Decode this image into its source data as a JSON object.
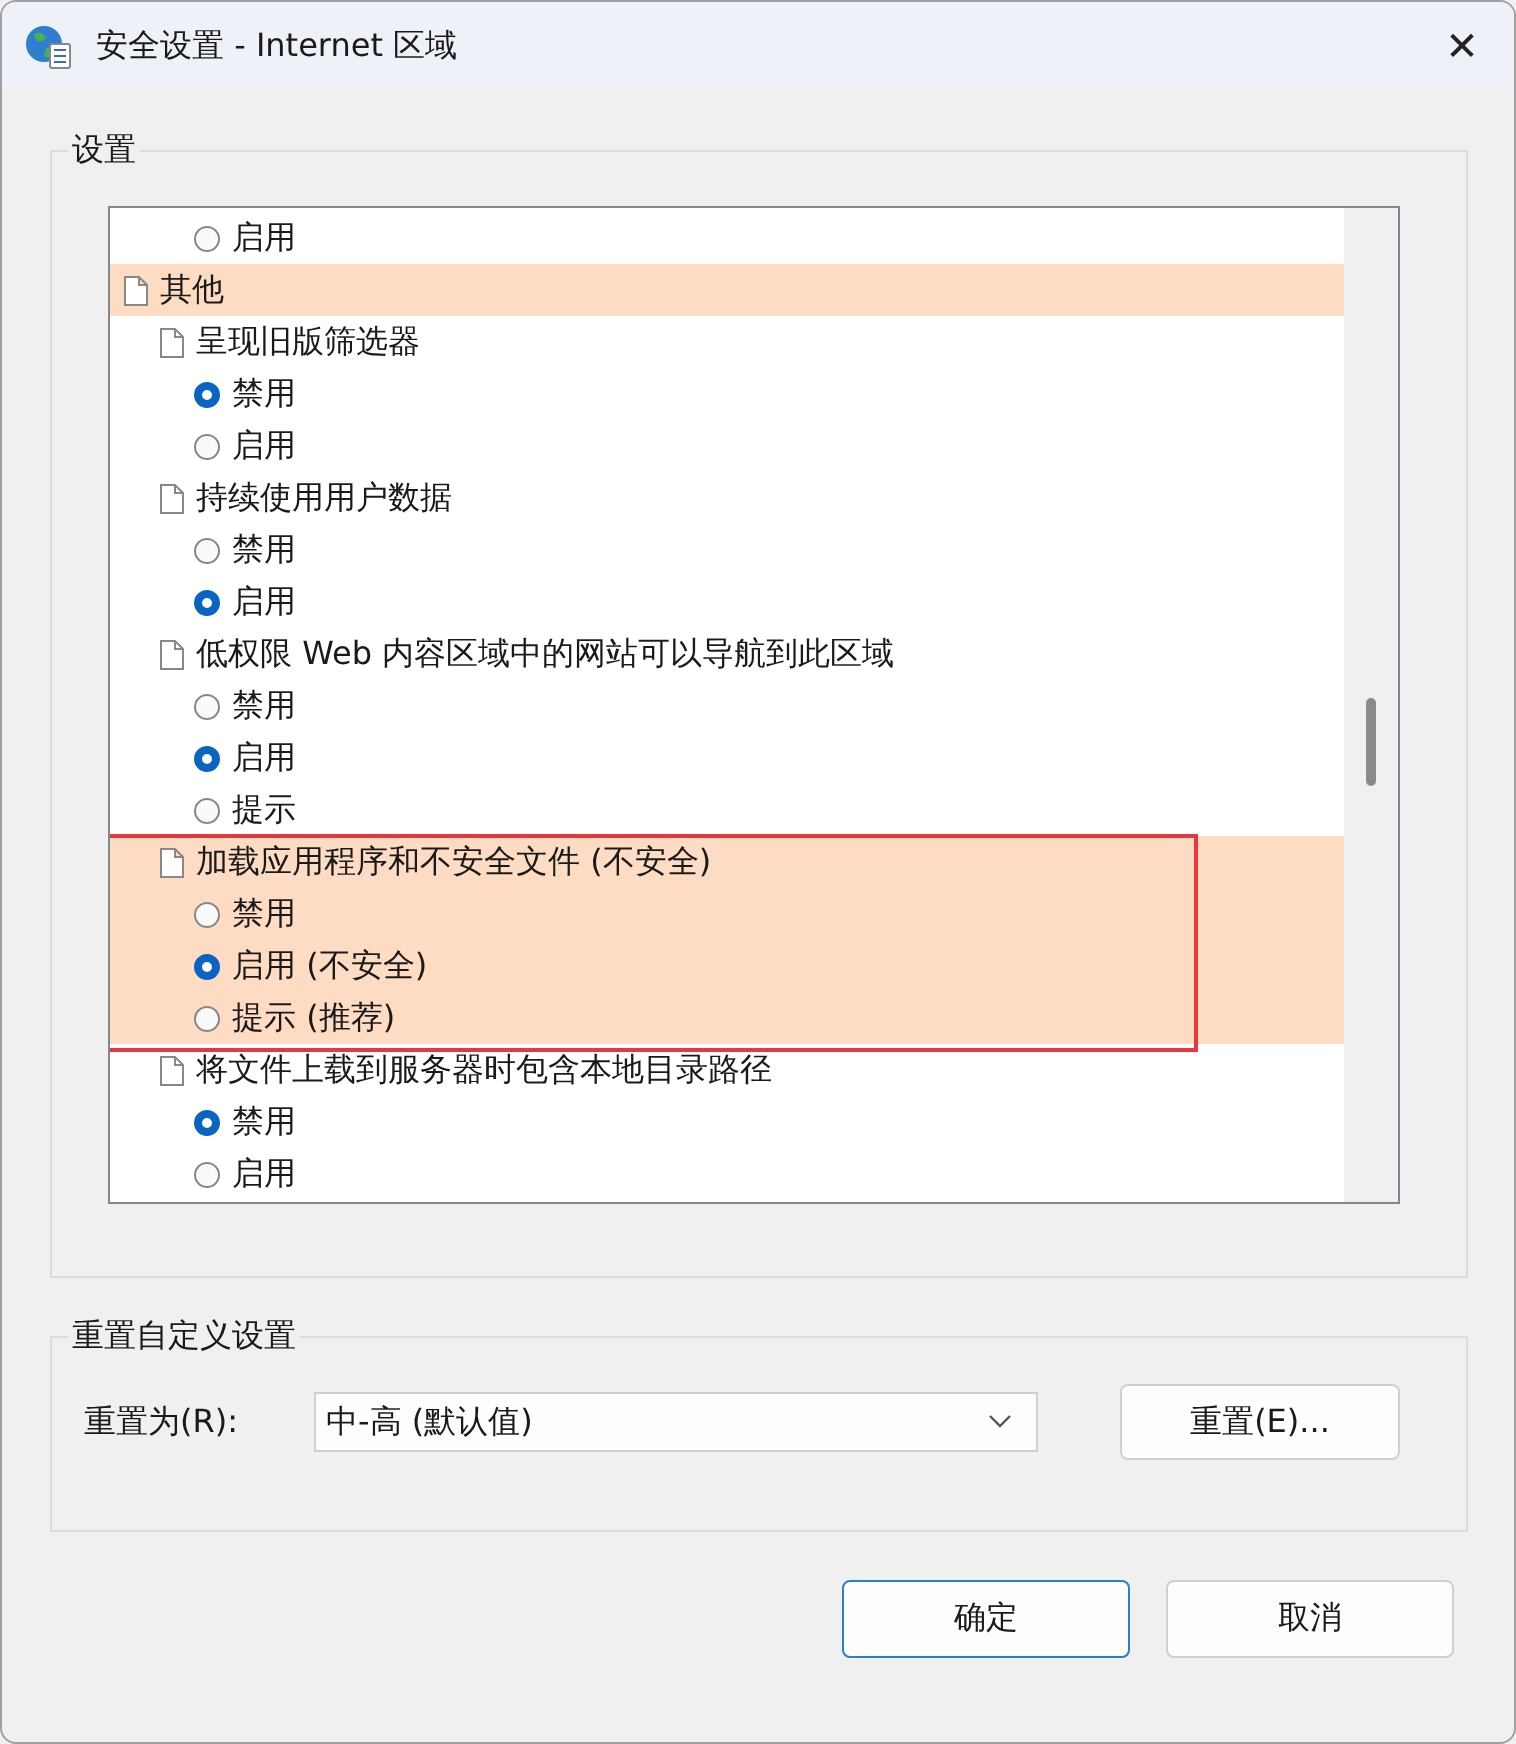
{
  "window": {
    "title": "安全设置 - Internet 区域",
    "close": "✕"
  },
  "settings_group": {
    "label": "设置",
    "tree": [
      {
        "kind": "option",
        "label": "启用",
        "selected": false,
        "highlighted": false
      },
      {
        "kind": "category",
        "label": "其他",
        "highlighted": true,
        "children": [
          {
            "kind": "setting",
            "label": "呈现旧版筛选器",
            "highlighted": false,
            "outlined": false,
            "children": [
              {
                "kind": "option",
                "label": "禁用",
                "selected": true
              },
              {
                "kind": "option",
                "label": "启用",
                "selected": false
              }
            ]
          },
          {
            "kind": "setting",
            "label": "持续使用用户数据",
            "highlighted": false,
            "outlined": false,
            "children": [
              {
                "kind": "option",
                "label": "禁用",
                "selected": false
              },
              {
                "kind": "option",
                "label": "启用",
                "selected": true
              }
            ]
          },
          {
            "kind": "setting",
            "label": "低权限 Web 内容区域中的网站可以导航到此区域",
            "highlighted": false,
            "outlined": false,
            "children": [
              {
                "kind": "option",
                "label": "禁用",
                "selected": false
              },
              {
                "kind": "option",
                "label": "启用",
                "selected": true
              },
              {
                "kind": "option",
                "label": "提示",
                "selected": false
              }
            ]
          },
          {
            "kind": "setting",
            "label": "加载应用程序和不安全文件 (不安全)",
            "highlighted": true,
            "outlined": true,
            "children": [
              {
                "kind": "option",
                "label": "禁用",
                "selected": false
              },
              {
                "kind": "option",
                "label": "启用 (不安全)",
                "selected": true
              },
              {
                "kind": "option",
                "label": "提示 (推荐)",
                "selected": false
              }
            ]
          },
          {
            "kind": "setting",
            "label": "将文件上载到服务器时包含本地目录路径",
            "highlighted": false,
            "outlined": false,
            "children": [
              {
                "kind": "option",
                "label": "禁用",
                "selected": true
              },
              {
                "kind": "option",
                "label": "启用",
                "selected": false
              }
            ]
          }
        ]
      }
    ]
  },
  "reset_group": {
    "label": "重置自定义设置",
    "reset_to_label": "重置为(R):",
    "reset_to_value": "中-高 (默认值)",
    "reset_button": "重置(E)..."
  },
  "buttons": [
    {
      "label": "确定",
      "default": true
    },
    {
      "label": "取消",
      "default": false
    }
  ]
}
